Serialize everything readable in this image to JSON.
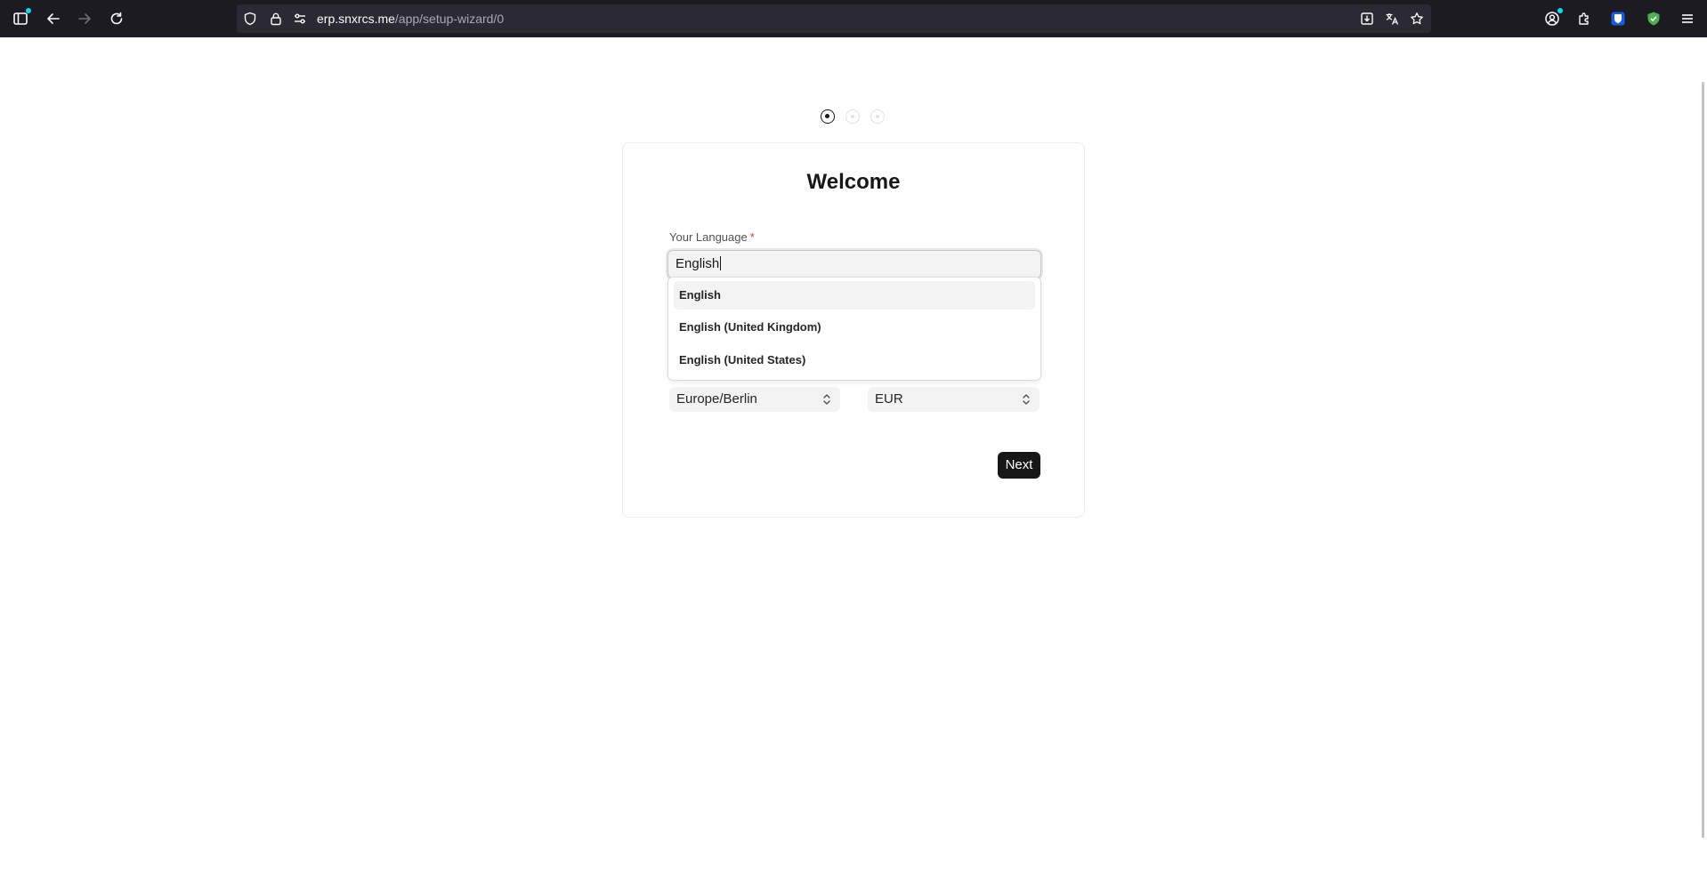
{
  "browser": {
    "url_host": "erp.snxrcs.me",
    "url_path": "/app/setup-wizard/0",
    "icons": [
      "sidebar-icon",
      "back-icon",
      "forward-icon",
      "reload-icon",
      "shield-icon",
      "lock-icon",
      "permissions-icon",
      "save-page-icon",
      "translate-icon",
      "bookmark-star-icon",
      "account-icon",
      "extensions-icon",
      "bitwarden-icon",
      "adblock-shield-icon",
      "menu-icon"
    ]
  },
  "wizard": {
    "steps": {
      "total": 3,
      "current": 1
    },
    "title": "Welcome",
    "language": {
      "label": "Your Language",
      "required_mark": "*",
      "value": "English",
      "options": [
        "English",
        "English (United Kingdom)",
        "English (United States)"
      ],
      "highlighted_index": 0
    },
    "timezone": {
      "value": "Europe/Berlin"
    },
    "currency": {
      "value": "EUR"
    },
    "next_label": "Next"
  },
  "colors": {
    "chrome_bg": "#1c1b22",
    "urlbar_bg": "#2b2a33",
    "primary_button": "#171717",
    "required": "#e03636"
  }
}
